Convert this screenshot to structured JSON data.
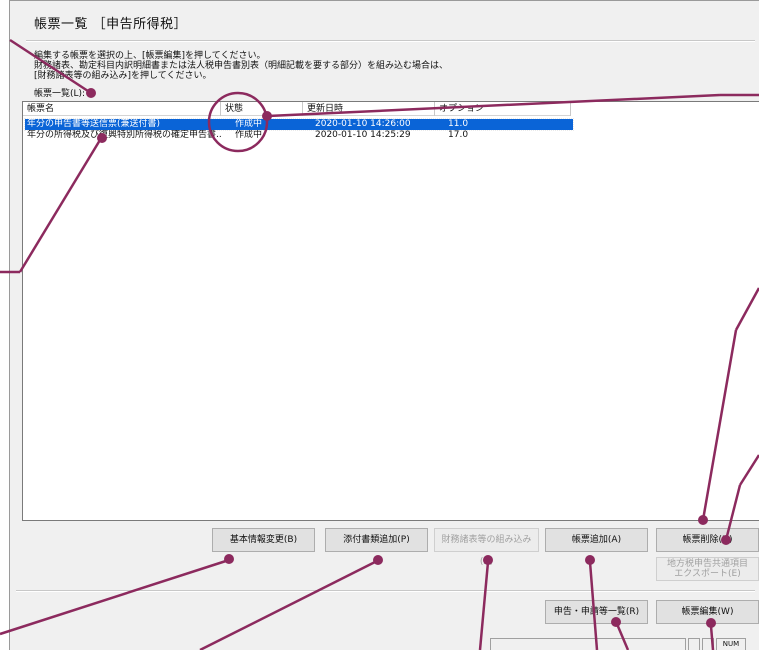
{
  "window": {
    "title": "帳票一覧 ［申告所得税］",
    "instructions": [
      "編集する帳票を選択の上、[帳票編集]を押してください。",
      "財務諸表、勘定科目内訳明細書または法人税申告書別表（明細記載を要する部分）を組み込む場合は、",
      "[財務諸表等の組み込み]を押してください。"
    ],
    "list_label": "帳票一覧(L):"
  },
  "table": {
    "columns": [
      "帳票名",
      "状態",
      "更新日時",
      "オプション"
    ],
    "rows": [
      {
        "name": "年分の申告書等送信票(兼送付書)",
        "status": "作成中",
        "updated": "2020-01-10 14:26:00",
        "option": "11.0"
      },
      {
        "name": "年分の所得税及び復興特別所得税の確定申告書...",
        "status": "作成中",
        "updated": "2020-01-10 14:25:29",
        "option": "17.0"
      }
    ]
  },
  "buttons": {
    "basic_info": "基本情報変更(B)",
    "attach_docs": "添付書類追加(P)",
    "import_fin": "財務諸表等の組み込み(X)",
    "add_form": "帳票追加(A)",
    "delete_form": "帳票削除(D)",
    "local_tax_export": [
      "地方税申告共通項目",
      "エクスポート(E)"
    ],
    "declaration_list": "申告・申請等一覧(R)",
    "edit_form": "帳票編集(W)"
  },
  "statusbar": {
    "num": "NUM"
  },
  "colors": {
    "annotation": "#8c2a5e",
    "selection": "#0a64d7"
  }
}
